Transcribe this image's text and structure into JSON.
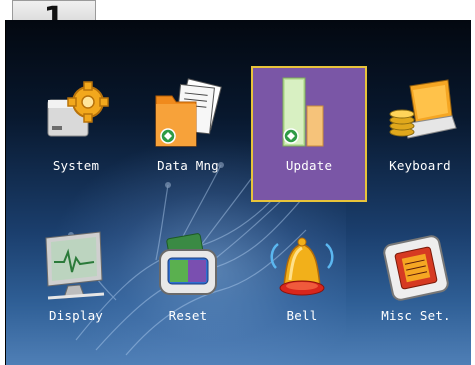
{
  "badge": {
    "text": "1"
  },
  "menu": {
    "items": [
      {
        "label": "System",
        "icon": "system-gear-icon",
        "selected": false
      },
      {
        "label": "Data Mng",
        "icon": "data-folder-icon",
        "selected": false
      },
      {
        "label": "Update",
        "icon": "update-icon",
        "selected": true
      },
      {
        "label": "Keyboard",
        "icon": "keyboard-coins-icon",
        "selected": false
      },
      {
        "label": "Display",
        "icon": "monitor-icon",
        "selected": false
      },
      {
        "label": "Reset",
        "icon": "reset-device-icon",
        "selected": false
      },
      {
        "label": "Bell",
        "icon": "bell-icon",
        "selected": false
      },
      {
        "label": "Misc Set.",
        "icon": "chip-icon",
        "selected": false
      }
    ]
  },
  "colors": {
    "selected_bg": "#7a56a6",
    "selected_border": "#e8c43a",
    "label_color": "#ffffff"
  }
}
